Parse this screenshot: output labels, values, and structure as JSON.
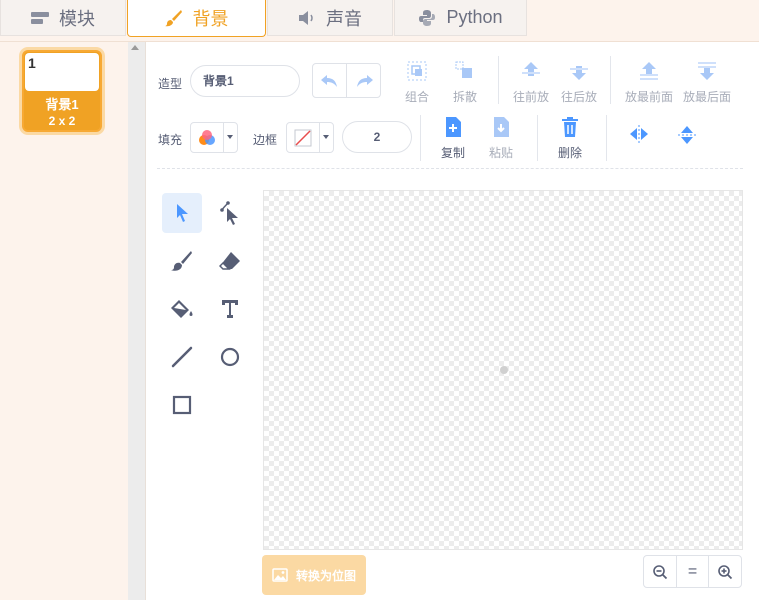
{
  "tabs": [
    {
      "label": "模块",
      "icon": "blocks-icon"
    },
    {
      "label": "背景",
      "icon": "paintbrush-icon"
    },
    {
      "label": "声音",
      "icon": "speaker-icon"
    },
    {
      "label": "Python",
      "icon": "python-icon"
    }
  ],
  "costume": {
    "number": "1",
    "name": "背景1",
    "size": "2 x 2"
  },
  "toolbar": {
    "costume_label": "造型",
    "costume_name": "背景1",
    "group": "组合",
    "ungroup": "拆散",
    "forward": "往前放",
    "backward": "往后放",
    "front": "放最前面",
    "back": "放最后面",
    "fill_label": "填充",
    "outline_label": "边框",
    "outline_width": "2",
    "copy": "复制",
    "paste": "粘贴",
    "delete": "删除"
  },
  "convert_label": "转换为位图",
  "zoom": {
    "equal": "="
  },
  "colors": {
    "accent": "#f0a224",
    "blue": "#4c97ff"
  }
}
